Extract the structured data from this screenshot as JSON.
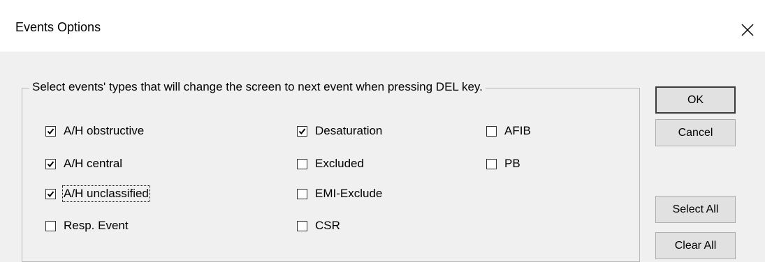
{
  "window": {
    "title": "Events Options"
  },
  "group": {
    "legend": "Select events' types that will change the screen to next event when pressing DEL key."
  },
  "checkboxes": [
    {
      "label": "A/H obstructive",
      "checked": true
    },
    {
      "label": "A/H central",
      "checked": true
    },
    {
      "label": "A/H unclassified",
      "checked": true,
      "focused": true
    },
    {
      "label": "Resp. Event",
      "checked": false
    },
    {
      "label": "Desaturation",
      "checked": true
    },
    {
      "label": "Excluded",
      "checked": false
    },
    {
      "label": "EMI-Exclude",
      "checked": false
    },
    {
      "label": "CSR",
      "checked": false
    },
    {
      "label": "AFIB",
      "checked": false
    },
    {
      "label": "PB",
      "checked": false
    }
  ],
  "buttons": {
    "ok": "OK",
    "cancel": "Cancel",
    "select_all": "Select All",
    "clear_all": "Clear All"
  },
  "icons": {
    "close": "close-icon",
    "check": "check-icon"
  }
}
